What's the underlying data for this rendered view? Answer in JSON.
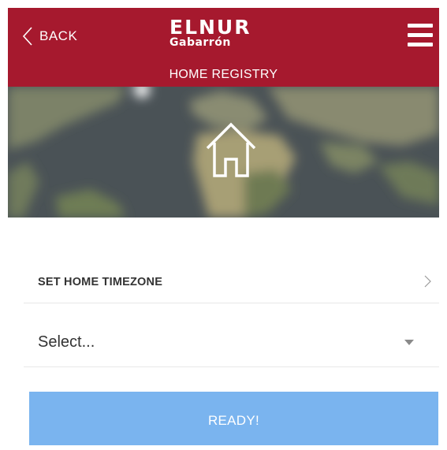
{
  "header": {
    "back_label": "BACK",
    "logo_line1": "ELNUR",
    "logo_line2": "Gabarrón",
    "subtitle": "HOME REGISTRY",
    "menu_icon": "hamburger-menu-icon",
    "back_icon": "chevron-left-icon"
  },
  "hero": {
    "image": "world-map-background",
    "icon": "home-icon"
  },
  "timezone": {
    "label": "SET HOME TIMEZONE",
    "icon": "chevron-right-icon"
  },
  "select": {
    "value": "Select...",
    "icon": "caret-down-icon"
  },
  "ready_button": {
    "label": "READY!"
  },
  "colors": {
    "header_bg": "#a6192e",
    "button_bg": "#7ab4ef",
    "text_dark": "#333333",
    "divider": "#e8e8e8"
  }
}
